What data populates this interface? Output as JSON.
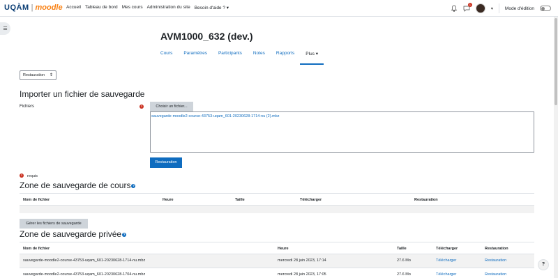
{
  "brand": {
    "uqam": "UQÀM",
    "separator": "|",
    "moodle": "moodle"
  },
  "nav": {
    "links": [
      "Accueil",
      "Tableau de bord",
      "Mes cours",
      "Administration du site",
      "Besoin d'aide ? ▾"
    ],
    "notification_count": "1",
    "edit_mode_label": "Mode d'édition"
  },
  "course": {
    "title": "AVM1000_632 (dev.)",
    "tabs": [
      "Cours",
      "Paramètres",
      "Participants",
      "Notes",
      "Rapports",
      "Plus ▾"
    ],
    "active_tab_index": 5
  },
  "select": {
    "value": "Restauration"
  },
  "import": {
    "heading": "Importer un fichier de sauvegarde",
    "files_label": "Fichiers",
    "choose_label": "Choisir un fichier...",
    "selected_file": "sauvegarde-moodle2-course-43753-uqam_601-20230628-1714-nu (2).mbz",
    "restore_label": "Restauration",
    "required_label": "requis"
  },
  "course_zone": {
    "heading": "Zone de sauvegarde de cours",
    "columns": [
      "Nom de fichier",
      "Heure",
      "Taille",
      "Télécharger",
      "Restauration"
    ],
    "manage_label": "Gérer les fichiers de sauvegarde"
  },
  "private_zone": {
    "heading": "Zone de sauvegarde privée",
    "columns": [
      "Nom de fichier",
      "Heure",
      "Taille",
      "Télécharger",
      "Restauration"
    ],
    "rows": [
      {
        "name": "sauvegarde-moodle2-course-43753-uqam_601-20230628-1714-nu.mbz",
        "time": "mercredi 28 juin 2023, 17:14",
        "size": "27.6 Mo",
        "download": "Télécharger",
        "restore": "Restauration"
      },
      {
        "name": "sauvegarde-moodle2-course-43753-uqam_601-20230628-1704-nu.mbz",
        "time": "mercredi 28 juin 2023, 17:05",
        "size": "27.6 Mo",
        "download": "Télécharger",
        "restore": "Restauration"
      }
    ]
  },
  "help": {
    "label": "?"
  }
}
